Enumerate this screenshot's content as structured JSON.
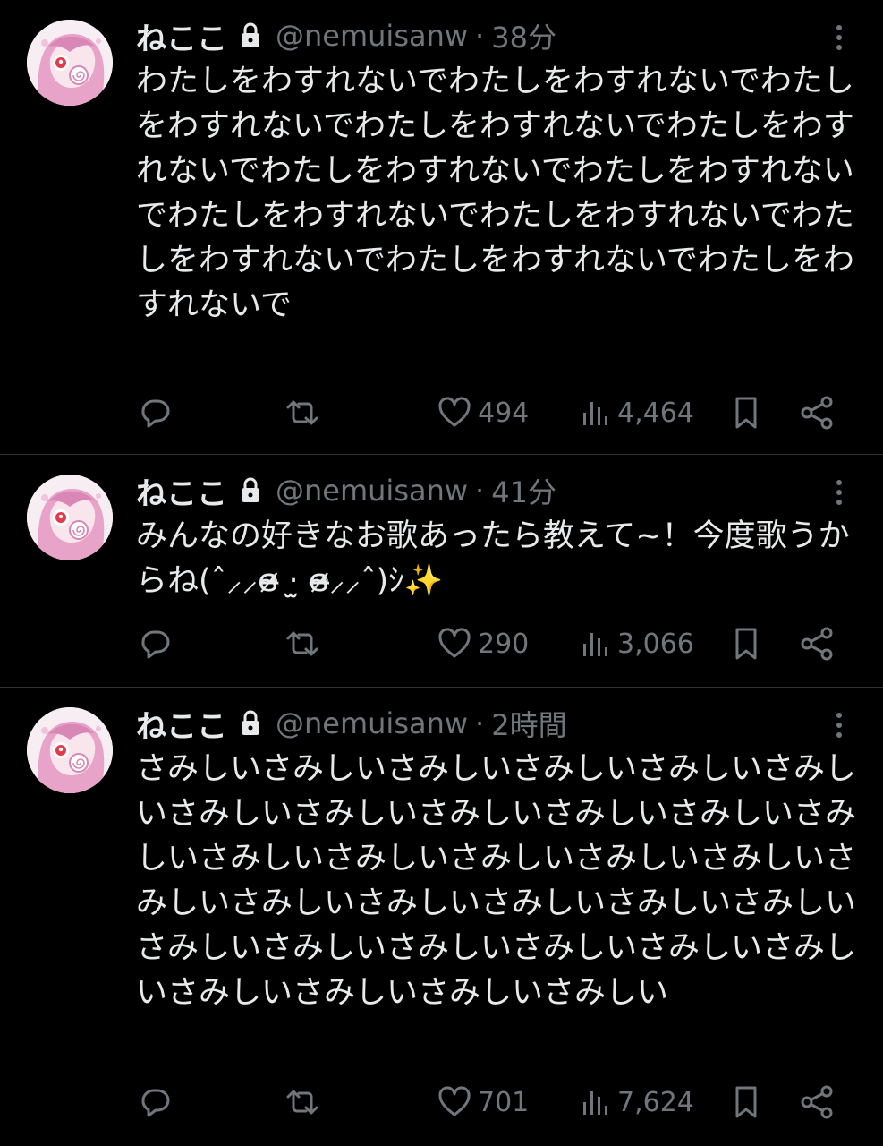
{
  "tweets": [
    {
      "display_name": "ねここ",
      "handle": "@nemuisanw",
      "separator": "·",
      "time": "38分",
      "text": "わたしをわすれないでわたしをわすれないでわたしをわすれないでわたしをわすれないでわたしをわすれないでわたしをわすれないでわたしをわすれないでわたしをわすれないでわたしをわすれないでわたしをわすれないでわたしをわすれないでわたしをわすれないで",
      "likes": "494",
      "views": "4,464"
    },
    {
      "display_name": "ねここ",
      "handle": "@nemuisanw",
      "separator": "·",
      "time": "41分",
      "text": "みんなの好きなお歌あったら教えて~！今度歌うからね(ˆ⸝⸝ɞ̴̶̷ ·̫ ɞ̴̶̷⸝⸝ˆ)ｼ✨",
      "likes": "290",
      "views": "3,066"
    },
    {
      "display_name": "ねここ",
      "handle": "@nemuisanw",
      "separator": "·",
      "time": "2時間",
      "text": "さみしいさみしいさみしいさみしいさみしいさみしいさみしいさみしいさみしいさみしいさみしいさみしいさみしいさみしいさみしいさみしいさみしいさみしいさみしいさみしいさみしいさみしいさみしいさみしいさみしいさみしいさみしいさみしいさみしいさみしいさみしいさみしいさみしい",
      "likes": "701",
      "views": "7,624"
    }
  ],
  "icons": {
    "reply": "reply-icon",
    "retweet": "retweet-icon",
    "like": "heart-icon",
    "views": "views-icon",
    "bookmark": "bookmark-icon",
    "share": "share-icon",
    "more": "more-icon",
    "lock": "lock-icon"
  },
  "colors": {
    "background": "#000000",
    "text": "#e7e9ea",
    "muted": "#71767b",
    "divider": "#2f3336",
    "avatar_hair": "#e8a3c8"
  }
}
